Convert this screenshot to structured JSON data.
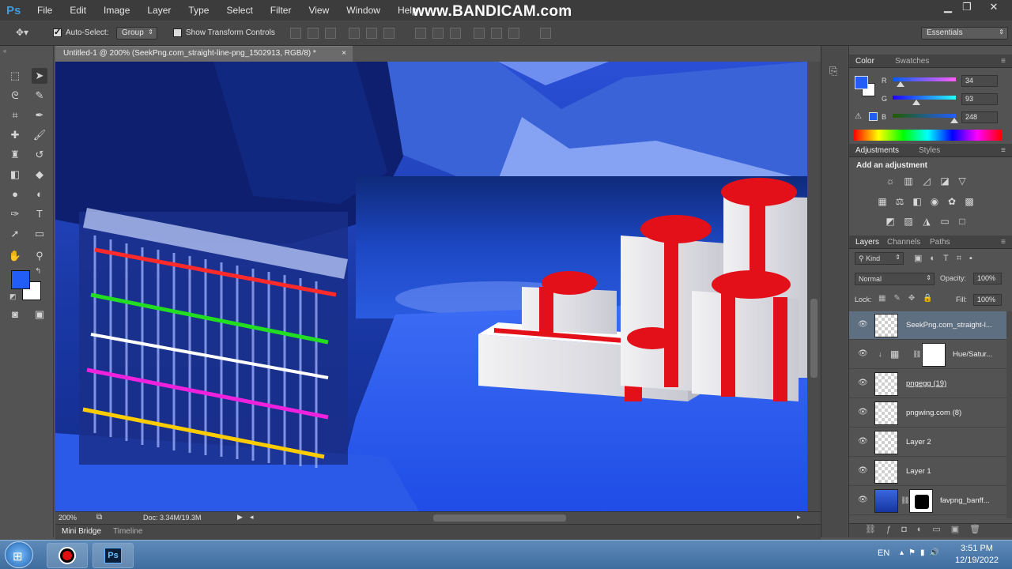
{
  "app": {
    "logo": "Ps",
    "watermark": "www.BANDICAM.com"
  },
  "menu": [
    "File",
    "Edit",
    "Image",
    "Layer",
    "Type",
    "Select",
    "Filter",
    "View",
    "Window",
    "Help"
  ],
  "window_controls": {
    "minimize": "▁",
    "restore": "❐",
    "close": "✕"
  },
  "options_bar": {
    "auto_select_label": "Auto-Select:",
    "auto_select_checked": true,
    "auto_select_value": "Group",
    "show_transform_label": "Show Transform Controls",
    "show_transform_checked": false,
    "workspace": "Essentials"
  },
  "document": {
    "tab_title": "Untitled-1 @ 200% (SeekPng.com_straight-line-png_1502913, RGB/8) *",
    "close": "×",
    "zoom": "200%",
    "doc_size": "Doc: 3.34M/19.3M"
  },
  "bottom_tabs": [
    "Mini Bridge",
    "Timeline"
  ],
  "color_panel": {
    "tabs": [
      "Color",
      "Swatches"
    ],
    "channels": [
      {
        "label": "R",
        "value": "34"
      },
      {
        "label": "G",
        "value": "93"
      },
      {
        "label": "B",
        "value": "248"
      }
    ],
    "foreground": "#225df8",
    "background": "#ffffff"
  },
  "adjustments_panel": {
    "tabs": [
      "Adjustments",
      "Styles"
    ],
    "heading": "Add an adjustment"
  },
  "layers_panel": {
    "tabs": [
      "Layers",
      "Channels",
      "Paths"
    ],
    "filter_kind": "Kind",
    "blend_mode": "Normal",
    "opacity_label": "Opacity:",
    "opacity_value": "100%",
    "lock_label": "Lock:",
    "fill_label": "Fill:",
    "fill_value": "100%",
    "layers": [
      {
        "name": "SeekPng.com_straight-l...",
        "selected": true,
        "underline": false
      },
      {
        "name": "Hue/Satur...",
        "selected": false,
        "underline": false
      },
      {
        "name": "pngegg (19)",
        "selected": false,
        "underline": true
      },
      {
        "name": "pngwing.com (8)",
        "selected": false,
        "underline": false
      },
      {
        "name": "Layer 2",
        "selected": false,
        "underline": false
      },
      {
        "name": "Layer 1",
        "selected": false,
        "underline": false
      },
      {
        "name": "favpng_banff...",
        "selected": false,
        "underline": false
      }
    ]
  },
  "taskbar": {
    "language": "EN",
    "time": "3:51 PM",
    "date": "12/19/2022",
    "ps_label": "Ps"
  },
  "icons": {
    "eye": "eye-icon",
    "move": "move-tool-icon"
  }
}
